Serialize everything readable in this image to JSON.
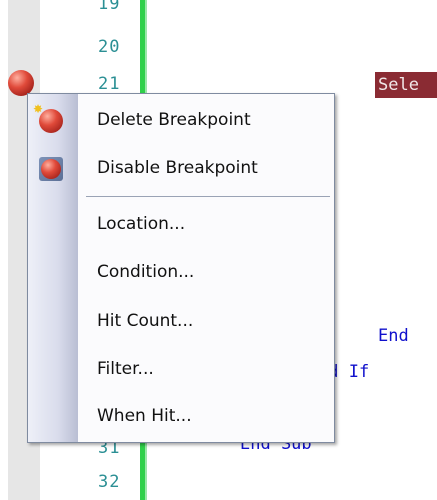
{
  "editor": {
    "line_numbers": [
      "19",
      "20",
      "21",
      "31",
      "32"
    ],
    "code_highlight": "Sele",
    "code_end_1": "End",
    "code_end_if": "nd If",
    "code_end_sub": "End Sub"
  },
  "context_menu": {
    "items": [
      {
        "label": "Delete Breakpoint",
        "icon": "delete-breakpoint-icon"
      },
      {
        "label": "Disable Breakpoint",
        "icon": "disable-breakpoint-icon"
      },
      {
        "label": "Location..."
      },
      {
        "label": "Condition..."
      },
      {
        "label": "Hit Count..."
      },
      {
        "label": "Filter..."
      },
      {
        "label": "When Hit..."
      }
    ]
  },
  "colors": {
    "line_number": "#2b8f94",
    "keyword": "#1010cc",
    "highlight_bg": "#8a2b33",
    "change_bar": "#2fd04a"
  }
}
